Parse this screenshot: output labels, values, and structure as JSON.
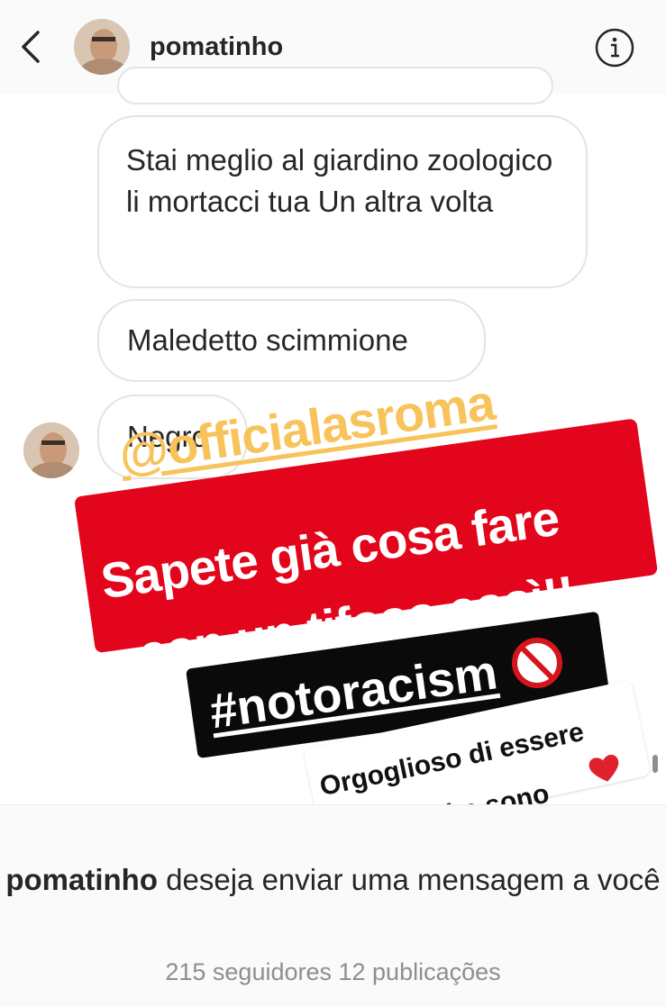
{
  "header": {
    "username": "pomatinho",
    "back_icon": "chevron-left-icon",
    "info_icon": "info-circle-icon"
  },
  "messages": [
    {
      "text": "Stai meglio al giardino zoologico li mortacci tua Un altra volta"
    },
    {
      "text": "Maledetto scimmione"
    },
    {
      "text": "Negro"
    }
  ],
  "overlay": {
    "mention": "@officialasroma",
    "red_line1": "Sapete già cosa fare",
    "red_line2": "con un tifoso così!!",
    "hashtag": "#notoracism",
    "note_line1": "Orgoglioso di essere",
    "note_line2": "quello che sono",
    "colors": {
      "mention": "#f8c35a",
      "red": "#e3051b",
      "black": "#0a0a0a"
    },
    "icons": [
      "prohibited-icon",
      "heart-icon"
    ]
  },
  "footer": {
    "request_name": "pomatinho",
    "request_text": " deseja enviar uma mensagem a você",
    "counts": "215 seguidores 12 publicações"
  }
}
